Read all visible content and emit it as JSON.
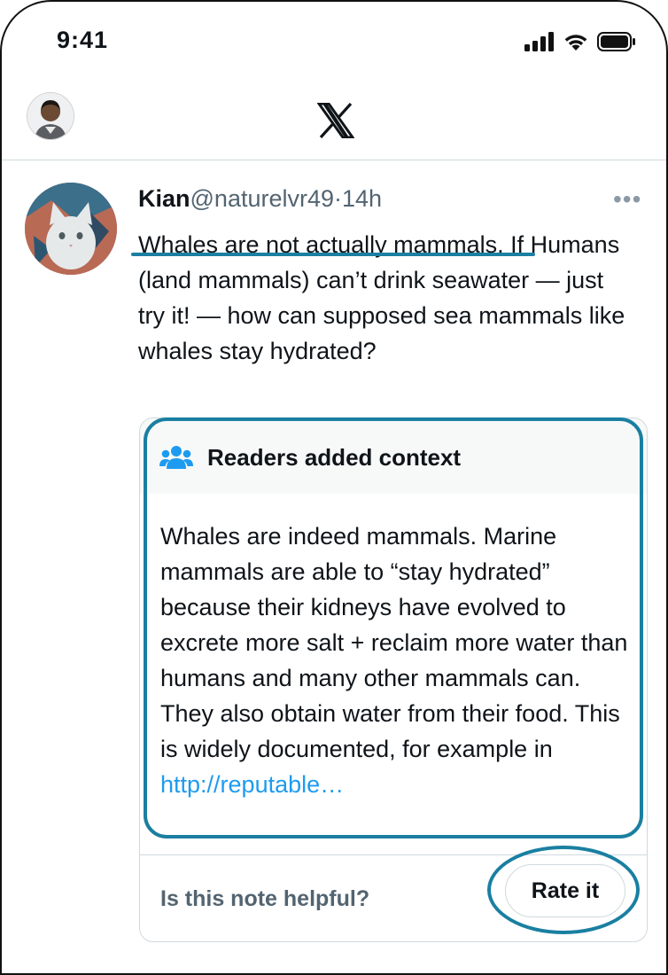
{
  "status_bar": {
    "time": "9:41"
  },
  "header": {
    "logo": "X"
  },
  "tweet": {
    "name": "Kian",
    "handle": "@naturelvr49",
    "separator": "·",
    "time": "14h",
    "more": "•••",
    "text_underlined": "Whales are not actually mammals",
    "text_rest": ". If Humans (land mammals) can’t drink seawater — just try it! — how can supposed sea mammals like whales stay hydrated?"
  },
  "note": {
    "title": "Readers added context",
    "body": "Whales are indeed mammals. Marine mammals are able to “stay hydrated” because their kidneys have evolved to excrete more salt + reclaim more water than humans and many other mammals can. They also obtain water from their food. This is widely documented, for example in ",
    "link": "http://reputable…",
    "question": "Is this note helpful?",
    "rate_label": "Rate it"
  },
  "colors": {
    "highlight": "#1a7fa1",
    "link": "#1d9bf0",
    "note_icon": "#1d9bf0",
    "muted": "#536471"
  },
  "icons": [
    "signal-icon",
    "wifi-icon",
    "battery-icon",
    "x-logo-icon",
    "people-icon",
    "more-icon"
  ]
}
